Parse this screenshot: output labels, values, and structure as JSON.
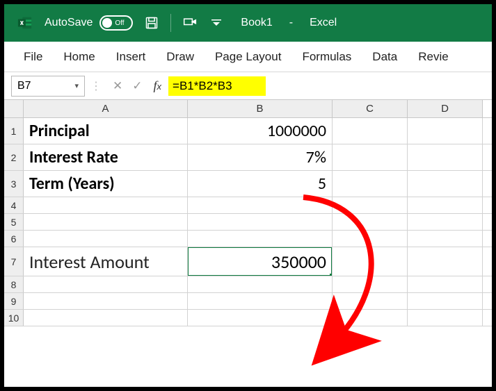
{
  "title": {
    "autosave": "AutoSave",
    "toggle_state": "Off",
    "doc": "Book1",
    "app": "Excel",
    "sep": "-"
  },
  "tabs": {
    "file": "File",
    "home": "Home",
    "insert": "Insert",
    "draw": "Draw",
    "page_layout": "Page Layout",
    "formulas": "Formulas",
    "data": "Data",
    "review": "Revie"
  },
  "namebox": "B7",
  "formula": "=B1*B2*B3",
  "cols": {
    "A": "A",
    "B": "B",
    "C": "C",
    "D": "D"
  },
  "rows": {
    "1": {
      "h": "1",
      "A": "Principal",
      "B": "1000000"
    },
    "2": {
      "h": "2",
      "A": "Interest Rate",
      "B": "7%"
    },
    "3": {
      "h": "3",
      "A": "Term (Years)",
      "B": "5"
    },
    "4": {
      "h": "4"
    },
    "5": {
      "h": "5"
    },
    "6": {
      "h": "6"
    },
    "7": {
      "h": "7",
      "A": "Interest Amount",
      "B": "350000"
    },
    "8": {
      "h": "8"
    },
    "9": {
      "h": "9"
    },
    "10": {
      "h": "10"
    }
  }
}
